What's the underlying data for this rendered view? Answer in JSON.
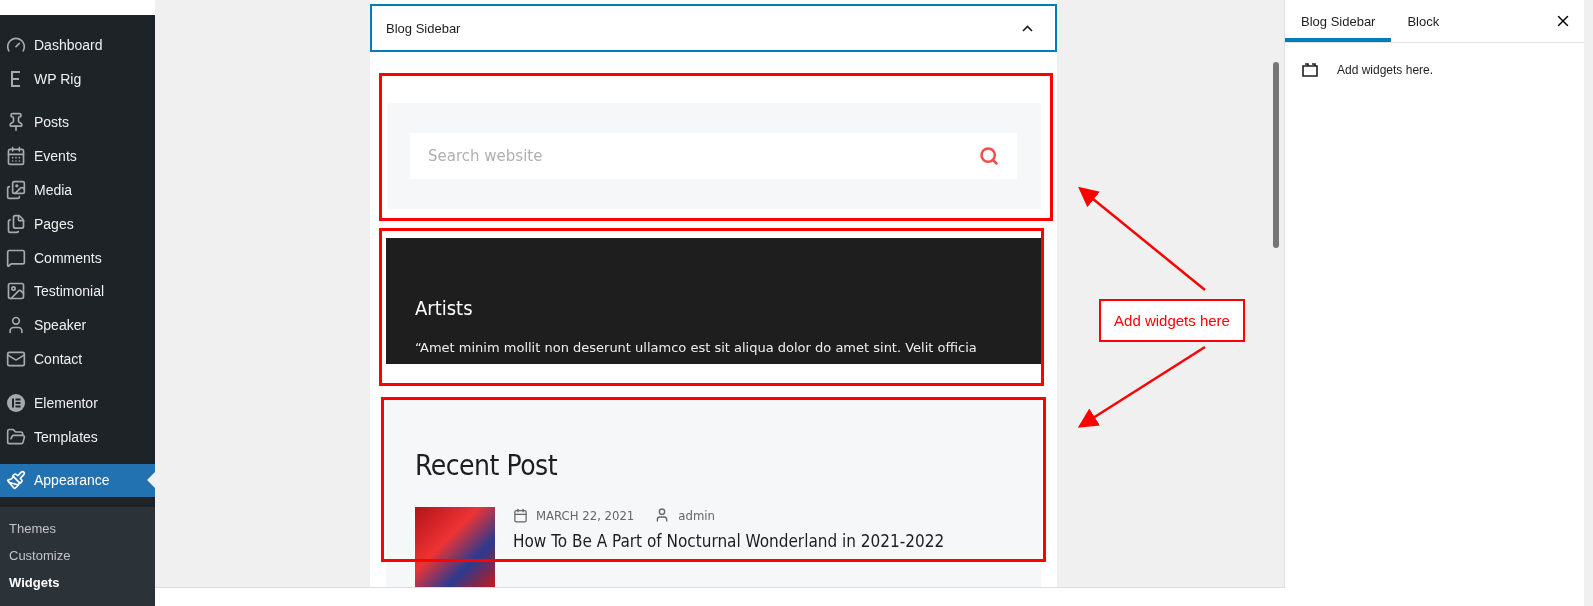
{
  "sidebar": {
    "groups": [
      [
        {
          "label": "Dashboard",
          "selected": false
        },
        {
          "label": "WP Rig",
          "selected": false
        }
      ],
      [
        {
          "label": "Posts",
          "selected": false
        },
        {
          "label": "Events",
          "selected": false
        },
        {
          "label": "Media",
          "selected": false
        },
        {
          "label": "Pages",
          "selected": false
        },
        {
          "label": "Comments",
          "selected": false
        },
        {
          "label": "Testimonial",
          "selected": false
        },
        {
          "label": "Speaker",
          "selected": false
        },
        {
          "label": "Contact",
          "selected": false
        }
      ],
      [
        {
          "label": "Elementor",
          "selected": false
        },
        {
          "label": "Templates",
          "selected": false
        }
      ],
      [
        {
          "label": "Appearance",
          "selected": true
        }
      ]
    ],
    "submenu": [
      {
        "label": "Themes",
        "selected": false
      },
      {
        "label": "Customize",
        "selected": false
      },
      {
        "label": "Widgets",
        "selected": true
      }
    ]
  },
  "editor": {
    "area_title": "Blog Sidebar",
    "expanded": true,
    "search_block": {
      "placeholder": "Search website"
    },
    "artists_block": {
      "title": "Artists",
      "text": "“Amet minim mollit non deserunt ullamco est sit aliqua dolor do amet sint. Velit officia"
    },
    "recent_block": {
      "title": "Recent Post",
      "posts": [
        {
          "date": "MARCH 22, 2021",
          "author": "admin",
          "title": "How To Be A Part of Nocturnal Wonderland in 2021-2022"
        }
      ]
    }
  },
  "annotation": {
    "label": "Add widgets here"
  },
  "settings_panel": {
    "tabs": [
      {
        "label": "Blog Sidebar",
        "selected": true
      },
      {
        "label": "Block",
        "selected": false
      }
    ],
    "message": "Add widgets here."
  }
}
